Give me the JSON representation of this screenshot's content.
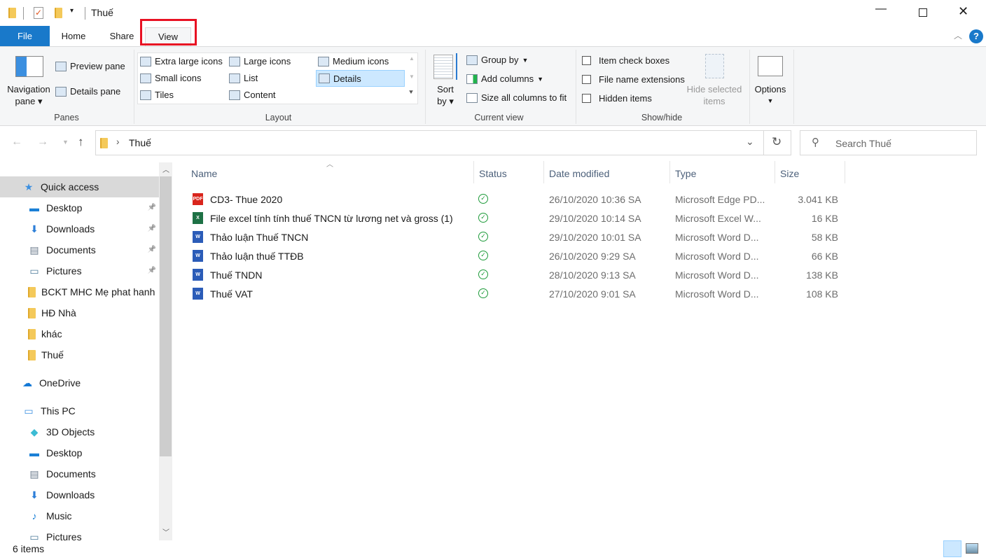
{
  "window": {
    "title": "Thuế"
  },
  "tabs": [
    {
      "label": "File"
    },
    {
      "label": "Home"
    },
    {
      "label": "Share"
    },
    {
      "label": "View"
    }
  ],
  "ribbon": {
    "panes": {
      "navigation_pane": "Navigation",
      "navigation_pane2": "pane",
      "preview_pane": "Preview pane",
      "details_pane": "Details pane",
      "label": "Panes"
    },
    "layout": {
      "items": [
        "Extra large icons",
        "Large icons",
        "Medium icons",
        "Small icons",
        "List",
        "Details",
        "Tiles",
        "Content"
      ],
      "selected": "Details",
      "label": "Layout"
    },
    "current_view": {
      "sort": "Sort",
      "sort2": "by",
      "group_by": "Group by",
      "add_columns": "Add columns",
      "size_columns": "Size all columns to fit",
      "label": "Current view"
    },
    "show_hide": {
      "item_check_boxes": "Item check boxes",
      "file_name_extensions": "File name extensions",
      "hidden_items": "Hidden items",
      "hide_selected": "Hide selected",
      "hide_selected2": "items",
      "label": "Show/hide"
    },
    "options": "Options"
  },
  "address": {
    "path": "Thuế",
    "search_placeholder": "Search Thuế"
  },
  "sidebar": {
    "items": [
      {
        "label": "Quick access",
        "icon": "star-icon"
      },
      {
        "label": "Desktop",
        "icon": "desktop-icon",
        "pinned": true
      },
      {
        "label": "Downloads",
        "icon": "download-icon",
        "pinned": true
      },
      {
        "label": "Documents",
        "icon": "documents-icon",
        "pinned": true
      },
      {
        "label": "Pictures",
        "icon": "pictures-icon",
        "pinned": true
      },
      {
        "label": "BCKT MHC Mẹ phat hanh",
        "icon": "folder-icon"
      },
      {
        "label": "HĐ Nhà",
        "icon": "folder-icon"
      },
      {
        "label": "khác",
        "icon": "folder-icon"
      },
      {
        "label": "Thuế",
        "icon": "folder-icon"
      },
      {
        "label": "OneDrive",
        "icon": "cloud-icon"
      },
      {
        "label": "This PC",
        "icon": "pc-icon"
      },
      {
        "label": "3D Objects",
        "icon": "cube-icon"
      },
      {
        "label": "Desktop",
        "icon": "desktop-icon"
      },
      {
        "label": "Documents",
        "icon": "documents-icon"
      },
      {
        "label": "Downloads",
        "icon": "download-icon"
      },
      {
        "label": "Music",
        "icon": "music-icon"
      },
      {
        "label": "Pictures",
        "icon": "pictures-icon"
      }
    ]
  },
  "columns": [
    "Name",
    "Status",
    "Date modified",
    "Type",
    "Size"
  ],
  "files": [
    {
      "name": "CD3- Thue  2020",
      "type_icon": "pdf",
      "date": "26/10/2020 10:36 SA",
      "type": "Microsoft Edge PD...",
      "size": "3.041 KB"
    },
    {
      "name": "File excel tính tính thuế TNCN từ lương net và gross (1)",
      "type_icon": "excel",
      "date": "29/10/2020 10:14 SA",
      "type": "Microsoft Excel W...",
      "size": "16 KB"
    },
    {
      "name": "Thảo luận Thuế TNCN",
      "type_icon": "word",
      "date": "29/10/2020 10:01 SA",
      "type": "Microsoft Word D...",
      "size": "58 KB"
    },
    {
      "name": "Thảo luận thuế TTĐB",
      "type_icon": "word",
      "date": "26/10/2020 9:29 SA",
      "type": "Microsoft Word D...",
      "size": "66 KB"
    },
    {
      "name": "Thuế TNDN",
      "type_icon": "word",
      "date": "28/10/2020 9:13 SA",
      "type": "Microsoft Word D...",
      "size": "138 KB"
    },
    {
      "name": "Thuế VAT",
      "type_icon": "word",
      "date": "27/10/2020 9:01 SA",
      "type": "Microsoft Word D...",
      "size": "108 KB"
    }
  ],
  "status": {
    "count": "6 items"
  },
  "colors": {
    "file_tab": "#1979ca",
    "highlight": "#e81123",
    "selection": "#cce8ff",
    "status_ok": "#1e9b3a"
  }
}
